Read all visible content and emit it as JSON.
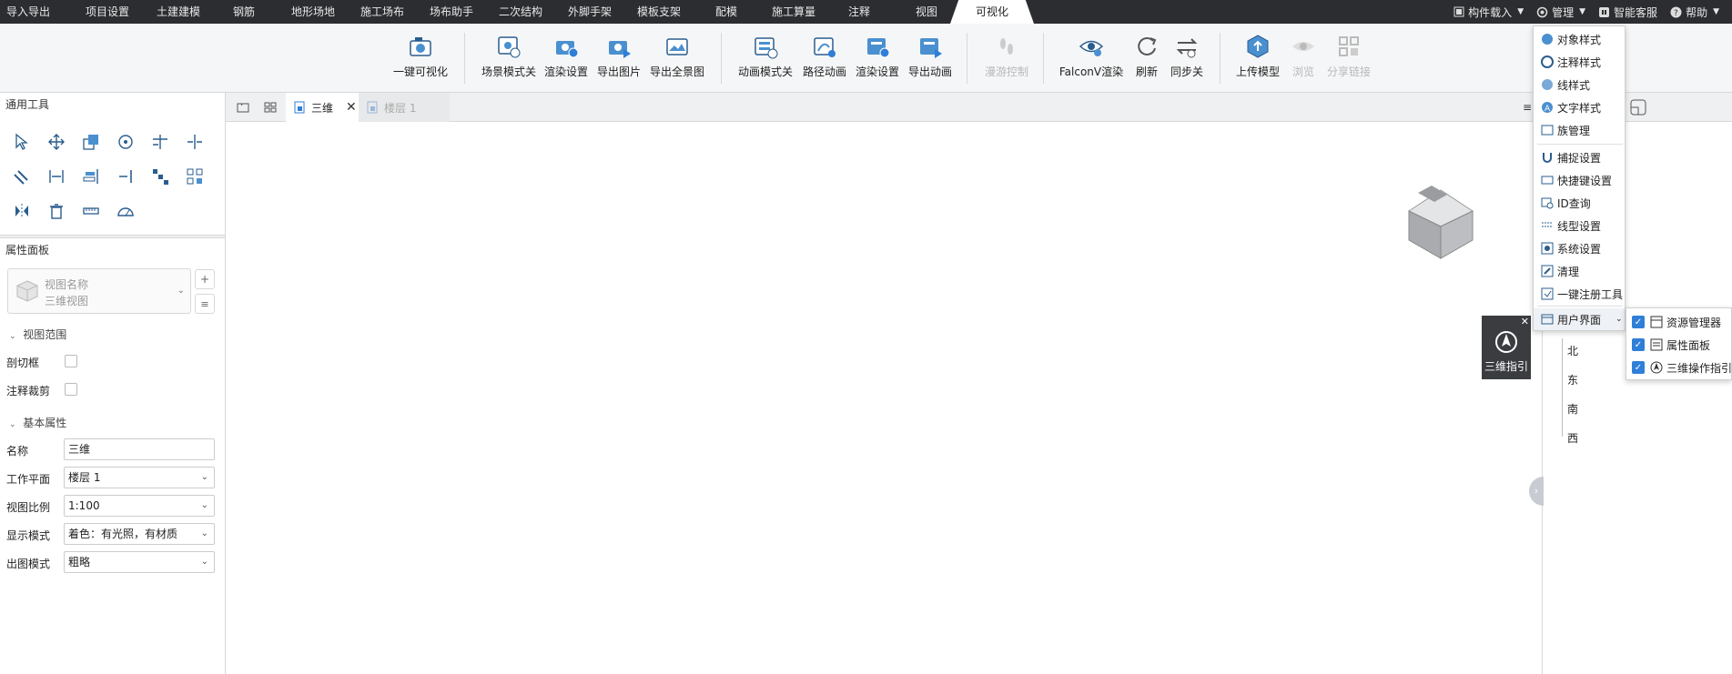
{
  "menu": {
    "tabs": [
      "导入导出",
      "项目设置",
      "土建建模",
      "钢筋",
      "地形场地",
      "施工场布",
      "场布助手",
      "二次结构",
      "外脚手架",
      "模板支架",
      "配模",
      "施工算量",
      "注释",
      "视图",
      "可视化"
    ],
    "active_tab": "可视化",
    "right": {
      "load_component": "构件载入",
      "manage": "管理",
      "service": "智能客服",
      "help": "帮助"
    }
  },
  "ribbon": {
    "one_click_visual": "一键可视化",
    "scene_mode_off": "场景模式关",
    "render_settings": "渲染设置",
    "export_image": "导出图片",
    "export_panorama": "导出全景图",
    "anim_mode_off": "动画模式关",
    "path_animation": "路径动画",
    "render_settings2": "渲染设置",
    "export_animation": "导出动画",
    "roam_control": "漫游控制",
    "falcon_render": "FalconV渲染",
    "refresh": "刷新",
    "sync_off": "同步关",
    "upload_model": "上传模型",
    "browse": "浏览",
    "share_link": "分享链接"
  },
  "left": {
    "general_tools": "通用工具",
    "property_panel": "属性面板",
    "view_name_placeholder": "视图名称",
    "view_name_value": "三维视图",
    "view_range": "视图范围",
    "section_box": "剖切框",
    "annotation_crop": "注释裁剪",
    "basic_props": "基本属性",
    "props": [
      {
        "label": "名称",
        "value": "三维",
        "dropdown": false
      },
      {
        "label": "工作平面",
        "value": "楼层 1",
        "dropdown": true
      },
      {
        "label": "视图比例",
        "value": "1:100",
        "dropdown": true
      },
      {
        "label": "显示模式",
        "value": "着色：有光照，有材质",
        "dropdown": true
      },
      {
        "label": "出图模式",
        "value": "粗略",
        "dropdown": true
      }
    ]
  },
  "doc_tabs": {
    "tab1": "三维",
    "tab2": "楼层 1"
  },
  "manage_menu": {
    "items": [
      "对象样式",
      "注释样式",
      "线样式",
      "文字样式",
      "族管理",
      "捕捉设置",
      "快捷键设置",
      "ID查询",
      "线型设置",
      "系统设置",
      "清理",
      "一键注册工具"
    ],
    "user_interface": "用户界面"
  },
  "ui_submenu": {
    "items": [
      "资源管理器",
      "属性面板",
      "三维操作指引"
    ]
  },
  "guide_label": "三维指引",
  "tree": [
    "北",
    "东",
    "南",
    "西"
  ],
  "colors": {
    "menubar": "#2b2d31",
    "accent": "#2f7fd8"
  }
}
